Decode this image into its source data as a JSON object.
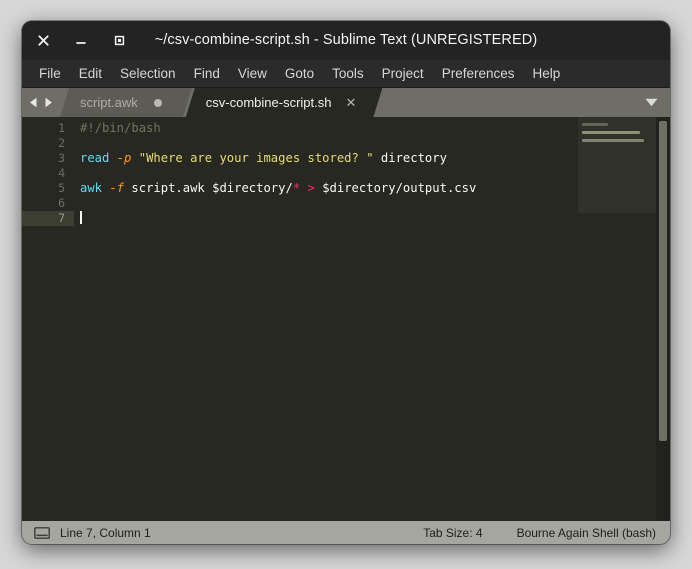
{
  "window": {
    "title": "~/csv-combine-script.sh - Sublime Text (UNREGISTERED)",
    "close_glyph": "✕",
    "minimize_glyph": "–",
    "maximize_glyph": "□"
  },
  "menubar": {
    "items": [
      {
        "label": "File"
      },
      {
        "label": "Edit"
      },
      {
        "label": "Selection"
      },
      {
        "label": "Find"
      },
      {
        "label": "View"
      },
      {
        "label": "Goto"
      },
      {
        "label": "Tools"
      },
      {
        "label": "Project"
      },
      {
        "label": "Preferences"
      },
      {
        "label": "Help"
      }
    ]
  },
  "tabbar": {
    "prev_glyph": "◀",
    "next_glyph": "▶",
    "menu_glyph": "▼",
    "close_glyph": "✕",
    "tabs": [
      {
        "label": "script.awk",
        "active": false,
        "dirty": true
      },
      {
        "label": "csv-combine-script.sh",
        "active": true,
        "dirty": false
      }
    ]
  },
  "editor": {
    "line_numbers": [
      "1",
      "2",
      "3",
      "4",
      "5",
      "6",
      "7"
    ],
    "current_line": 7,
    "lines": [
      {
        "n": 1,
        "text": "#!/bin/bash"
      },
      {
        "n": 2,
        "text": ""
      },
      {
        "n": 3,
        "text": "read -p \"Where are your images stored? \" directory"
      },
      {
        "n": 4,
        "text": ""
      },
      {
        "n": 5,
        "text": "awk -f script.awk $directory/* > $directory/output.csv"
      },
      {
        "n": 6,
        "text": ""
      },
      {
        "n": 7,
        "text": ""
      }
    ],
    "line1_comment": "#!/bin/bash",
    "line3_cmd": "read",
    "line3_flag": "-p",
    "line3_string": "\"Where are your images stored? \"",
    "line3_var": "directory",
    "line5_cmd": "awk",
    "line5_flag": "-f",
    "line5_file": "script.awk $directory/",
    "line5_glob": "*",
    "line5_redirect": ">",
    "line5_out": "$directory/output.csv",
    "space": " "
  },
  "statusbar": {
    "cursor_position": "Line 7, Column 1",
    "tab_size": "Tab Size: 4",
    "syntax": "Bourne Again Shell (bash)"
  },
  "colors": {
    "editor_bg": "#272822",
    "comment": "#75715e",
    "function": "#66d9ef",
    "flag": "#fd9720",
    "string": "#e6db74",
    "operator": "#f92672",
    "plain": "#f8f8f2",
    "titlebar_bg": "#232323",
    "menubar_bg": "#2b2b2b",
    "tabbar_bg": "#6e6e67",
    "statusbar_bg": "#a6a6a0"
  }
}
